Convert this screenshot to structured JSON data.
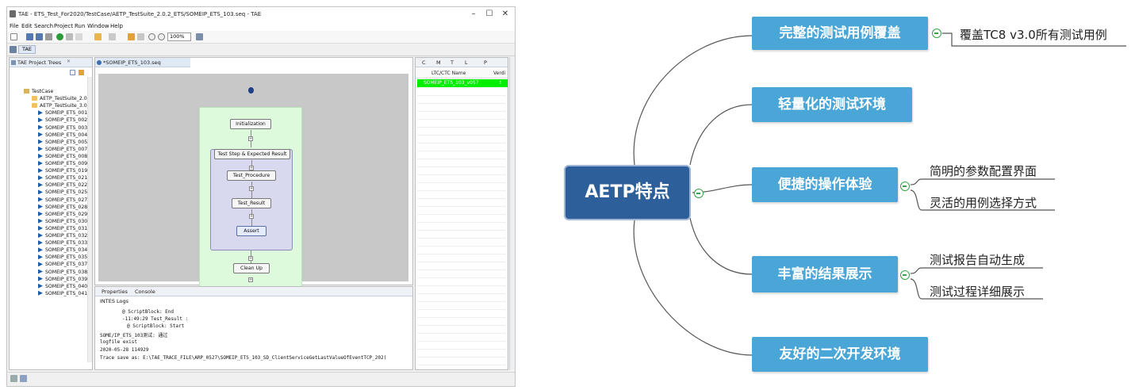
{
  "ide": {
    "title": "TAE - ETS_Test_For2020/TestCase/AETP_TestSuite_2.0.2_ETS/SOMEIP_ETS_103.seq - TAE",
    "window_controls": [
      "–",
      "☐",
      "✕"
    ],
    "menu": [
      "File",
      "Edit",
      "Search",
      "Project",
      "Run",
      "Window",
      "Help"
    ],
    "zoom": "100%",
    "perspective_label": "TAE",
    "project_tree": {
      "tab_label": "TAE Project Trees",
      "root": "TestCase",
      "suites": [
        "AETP_TestSuite_2.0.2",
        "AETP_TestSuite_3.0.1"
      ],
      "cases": [
        "SOMEIP_ETS_001",
        "SOMEIP_ETS_002",
        "SOMEIP_ETS_003",
        "SOMEIP_ETS_004",
        "SOMEIP_ETS_005",
        "SOMEIP_ETS_007",
        "SOMEIP_ETS_008",
        "SOMEIP_ETS_009",
        "SOMEIP_ETS_019",
        "SOMEIP_ETS_021",
        "SOMEIP_ETS_022",
        "SOMEIP_ETS_025",
        "SOMEIP_ETS_027",
        "SOMEIP_ETS_028",
        "SOMEIP_ETS_029",
        "SOMEIP_ETS_030",
        "SOMEIP_ETS_031",
        "SOMEIP_ETS_032",
        "SOMEIP_ETS_033",
        "SOMEIP_ETS_034",
        "SOMEIP_ETS_035",
        "SOMEIP_ETS_037",
        "SOMEIP_ETS_038",
        "SOMEIP_ETS_039",
        "SOMEIP_ETS_040",
        "SOMEIP_ETS_041"
      ]
    },
    "editor": {
      "tab_label": "*SOMEIP_ETS_103.seq",
      "steps": {
        "init": "Initialization",
        "group": "Test Step & Expected Result",
        "procedure": "Test_Procedure",
        "result": "Test_Result",
        "assert": "Assert",
        "cleanup": "Clean Up"
      }
    },
    "results": {
      "tabs": [
        "C",
        "M",
        "T",
        "L",
        "P"
      ],
      "col_name": "LTC/CTC Name",
      "col_verdict": "Verdi",
      "row_name": "SOMEIP_ETS_103_v057",
      "row_verdict": "t",
      "pass_color": "#00ee00"
    },
    "console": {
      "tabs": [
        "Properties",
        "Console"
      ],
      "header": "INTES Logs",
      "lines": [
        "@ ScriptBlock: End",
        "-11:49:29 Test_Result :",
        "@ ScriptBlock: Start",
        "SOME/IP_ETS_103测试: 通过",
        "logfile exist",
        "2020-05-28 114929",
        "Trace save as:    E:\\TAE_TRACE_FILE\\ARP_0527\\SOMEIP_ETS_103_SD_ClientServiceGetLastValueOfEventTCP_202("
      ]
    }
  },
  "mindmap": {
    "center": "AETP特点",
    "branches": [
      {
        "label": "完整的测试用例覆盖",
        "children": [
          "覆盖TC8 v3.0所有测试用例"
        ]
      },
      {
        "label": "轻量化的测试环境",
        "children": []
      },
      {
        "label": "便捷的操作体验",
        "children": [
          "简明的参数配置界面",
          "灵活的用例选择方式"
        ]
      },
      {
        "label": "丰富的结果展示",
        "children": [
          "测试报告自动生成",
          "测试过程详细展示"
        ]
      },
      {
        "label": "友好的二次开发环境",
        "children": []
      }
    ],
    "colors": {
      "branch": "#4aa6d6",
      "center": "#2d5f9b",
      "toggle": "#36a24a"
    }
  }
}
